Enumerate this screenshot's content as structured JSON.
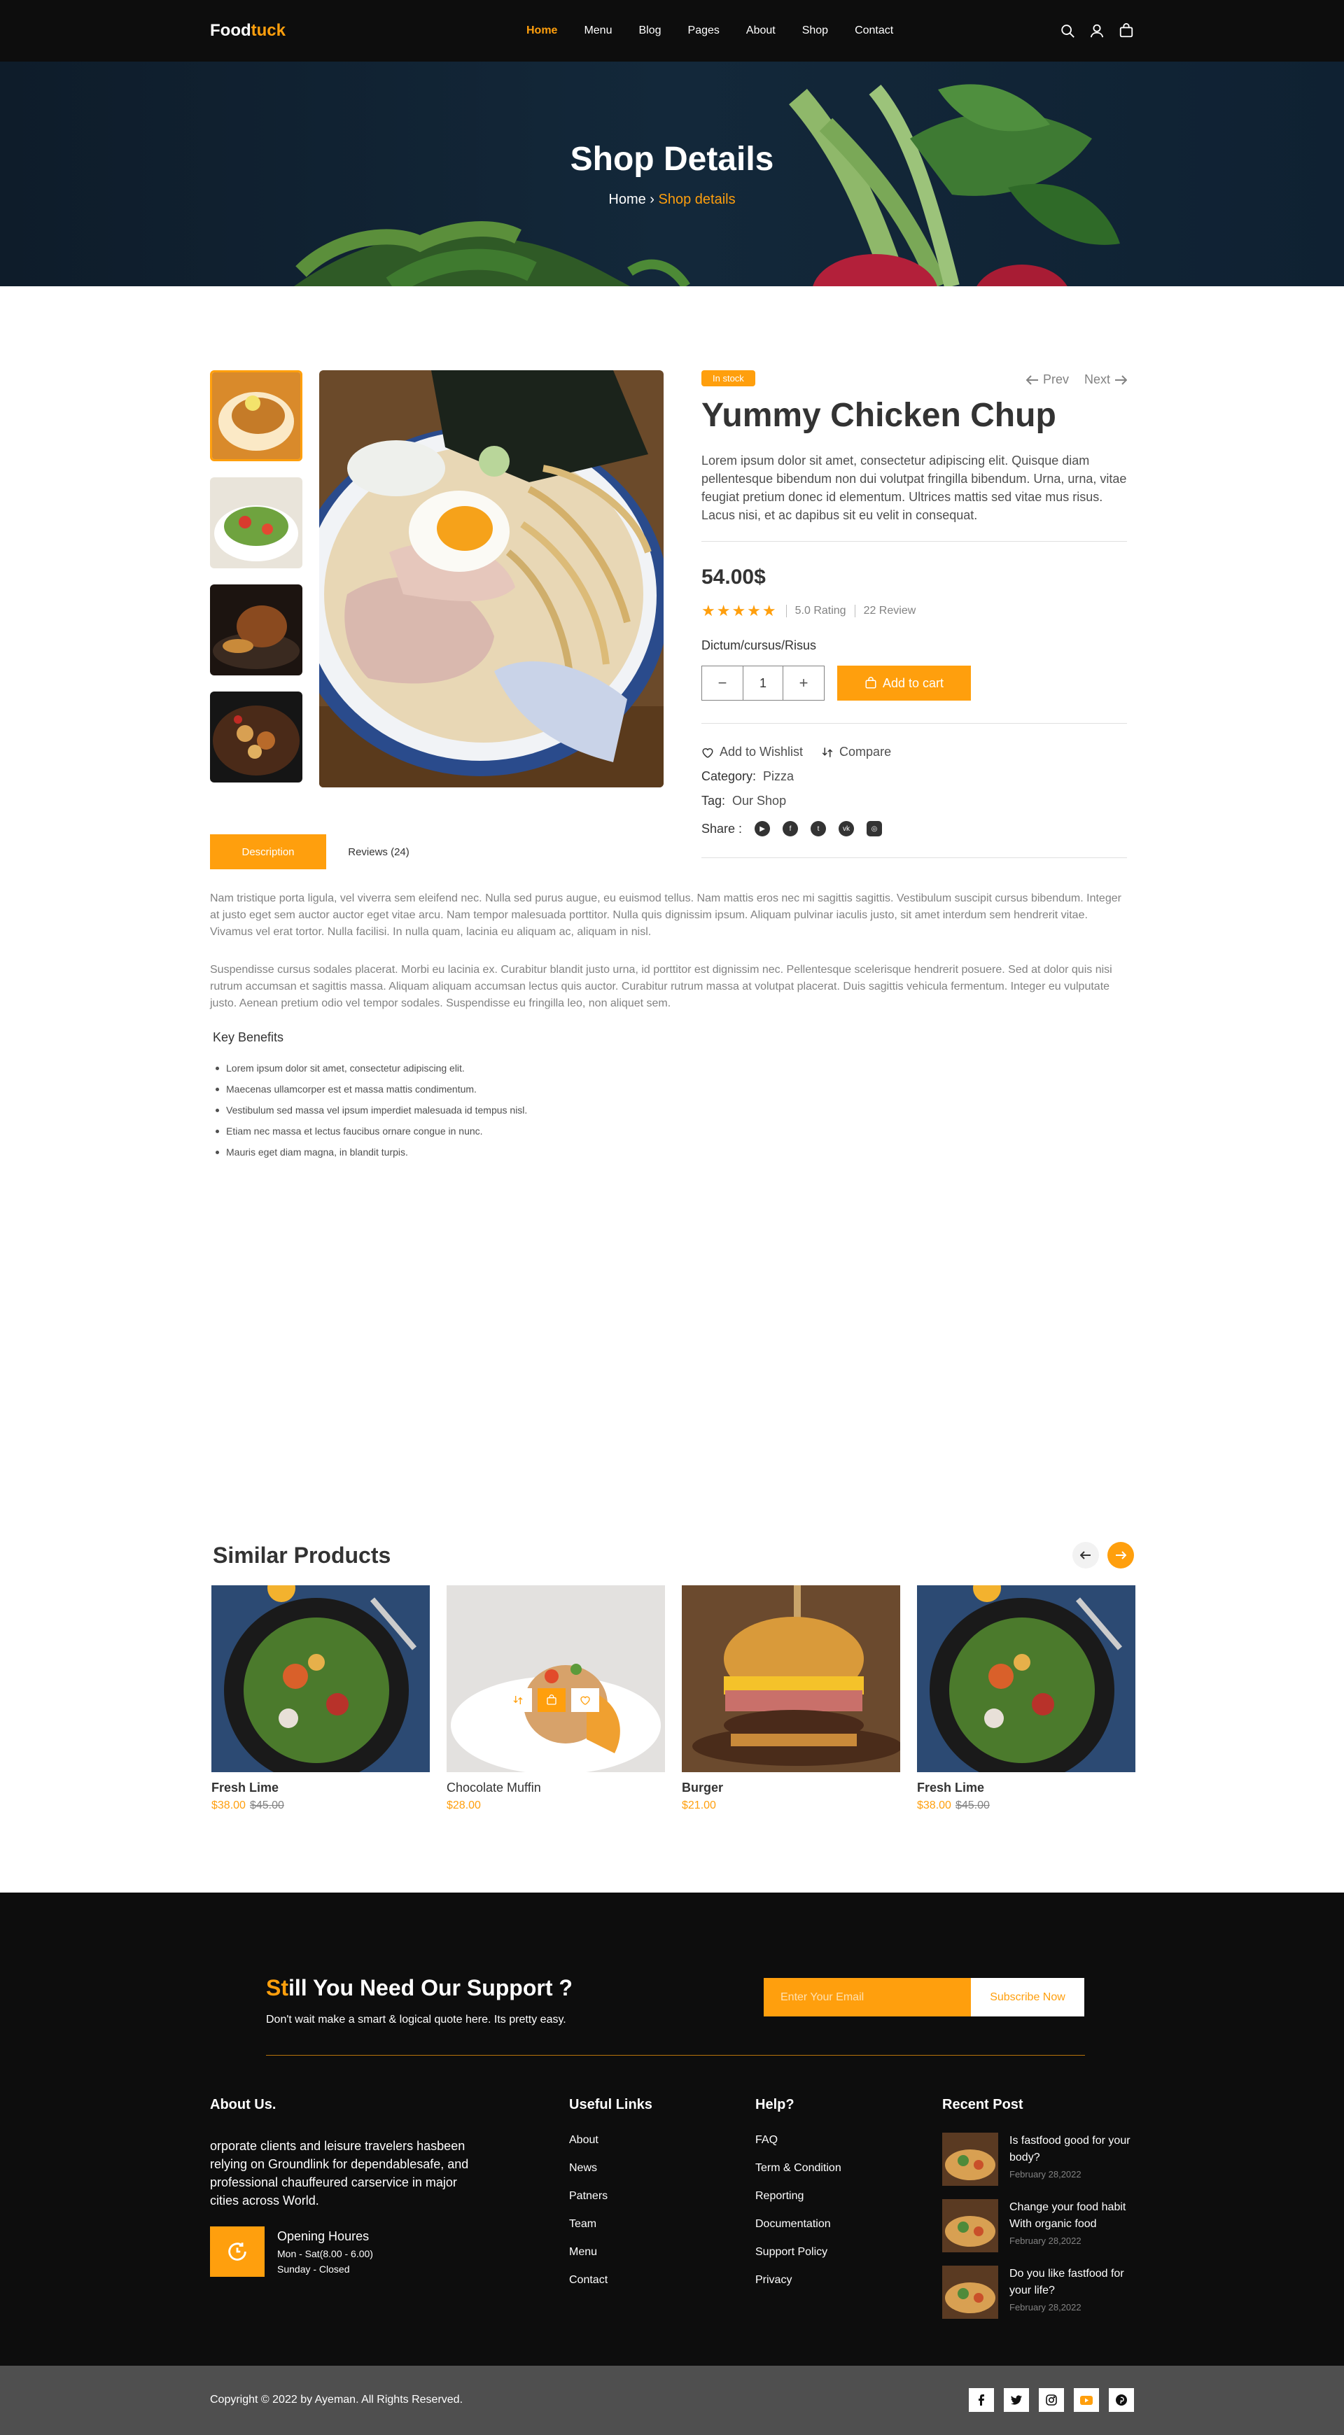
{
  "header": {
    "logo_a": "Food",
    "logo_b": "tuck",
    "nav": [
      "Home",
      "Menu",
      "Blog",
      "Pages",
      "About",
      "Shop",
      "Contact"
    ],
    "icons": [
      "search-icon",
      "user-icon",
      "bag-icon"
    ]
  },
  "hero": {
    "title": "Shop Details",
    "crumb_home": "Home",
    "crumb_sep": "›",
    "crumb_current": "Shop details"
  },
  "product": {
    "badge": "In stock",
    "prev": "Prev",
    "next": "Next",
    "title": "Yummy Chicken Chup",
    "description": "Lorem ipsum dolor sit amet, consectetur adipiscing elit. Quisque diam pellentesque bibendum non dui volutpat fringilla bibendum. Urna, urna, vitae feugiat pretium donec id elementum. Ultrices mattis sed vitae mus risus. Lacus nisi, et ac dapibus sit eu velit in consequat.",
    "price": "54.00$",
    "stars": "★★★★★",
    "rating": "5.0 Rating",
    "reviews": "22 Review",
    "dictum": "Dictum/cursus/Risus",
    "qty_minus": "−",
    "qty": "1",
    "qty_plus": "+",
    "add_to_cart": "Add to cart",
    "wishlist": "Add to Wishlist",
    "compare": "Compare",
    "category_label": "Category:",
    "category": "Pizza",
    "tag_label": "Tag:",
    "tag": "Our Shop",
    "share_label": "Share :"
  },
  "tabs": {
    "description": "Description",
    "reviews": "Reviews (24)"
  },
  "details": {
    "p1": "Nam tristique porta ligula, vel viverra sem eleifend nec. Nulla sed purus augue, eu euismod tellus. Nam mattis eros nec mi sagittis sagittis. Vestibulum suscipit cursus bibendum. Integer at justo eget sem auctor auctor eget vitae arcu. Nam tempor malesuada porttitor. Nulla quis dignissim ipsum. Aliquam pulvinar iaculis justo, sit amet interdum sem hendrerit vitae. Vivamus vel erat tortor. Nulla facilisi. In nulla quam, lacinia eu aliquam ac, aliquam in nisl.",
    "p2": "Suspendisse cursus sodales placerat. Morbi eu lacinia ex. Curabitur blandit justo urna, id porttitor est dignissim nec. Pellentesque scelerisque hendrerit posuere. Sed at dolor quis nisi rutrum accumsan et sagittis massa. Aliquam aliquam accumsan lectus quis auctor. Curabitur rutrum massa at volutpat placerat. Duis sagittis vehicula fermentum. Integer eu vulputate justo. Aenean pretium odio vel tempor sodales. Suspendisse eu fringilla leo, non aliquet sem.",
    "benefits_title": "Key Benefits",
    "benefits": [
      "Lorem ipsum dolor sit amet, consectetur adipiscing elit.",
      "Maecenas ullamcorper est et massa mattis condimentum.",
      "Vestibulum sed massa vel ipsum imperdiet malesuada id tempus nisl.",
      "Etiam nec massa et lectus faucibus ornare congue in nunc.",
      "Mauris eget diam magna, in blandit turpis."
    ]
  },
  "similar": {
    "title": "Similar Products",
    "items": [
      {
        "name": "Fresh Lime",
        "price": "$38.00",
        "old": "$45.00"
      },
      {
        "name": "Chocolate Muffin",
        "price": "$28.00",
        "old": ""
      },
      {
        "name": "Burger",
        "price": "$21.00",
        "old": ""
      },
      {
        "name": "Fresh Lime",
        "price": "$38.00",
        "old": "$45.00"
      }
    ]
  },
  "footer": {
    "support_a": "St",
    "support_b": "ill You Need Our Support ?",
    "support_sub": "Don't wait make a smart & logical quote here. Its pretty easy.",
    "email_placeholder": "Enter Your Email",
    "subscribe": "Subscribe Now",
    "about_title": "About Us.",
    "about_text": "orporate clients and leisure travelers hasbeen relying on Groundlink for dependablesafe, and professional chauffeured carservice in major cities across World.",
    "hours_title": "Opening Houres",
    "hours_1": "Mon - Sat(8.00 - 6.00)",
    "hours_2": "Sunday - Closed",
    "useful_title": "Useful Links",
    "useful": [
      "About",
      "News",
      "Patners",
      "Team",
      "Menu",
      "Contact"
    ],
    "help_title": "Help?",
    "help": [
      "FAQ",
      "Term & Condition",
      "Reporting",
      "Documentation",
      "Support Policy",
      "Privacy"
    ],
    "recent_title": "Recent Post",
    "posts": [
      {
        "title": "Is fastfood good for your body?",
        "date": "February 28,2022"
      },
      {
        "title": "Change your food habit With organic food",
        "date": "February 28,2022"
      },
      {
        "title": "Do you like fastfood for your life?",
        "date": "February 28,2022"
      }
    ],
    "copyright": "Copyright © 2022 by Ayeman. All Rights Reserved.",
    "social_icons": [
      "facebook-icon",
      "twitter-icon",
      "instagram-icon",
      "youtube-icon",
      "pinterest-icon"
    ]
  },
  "colors": {
    "accent": "#ff9f0d",
    "dark": "#0d0d0d",
    "copyright_bg": "#4f4f4f"
  }
}
